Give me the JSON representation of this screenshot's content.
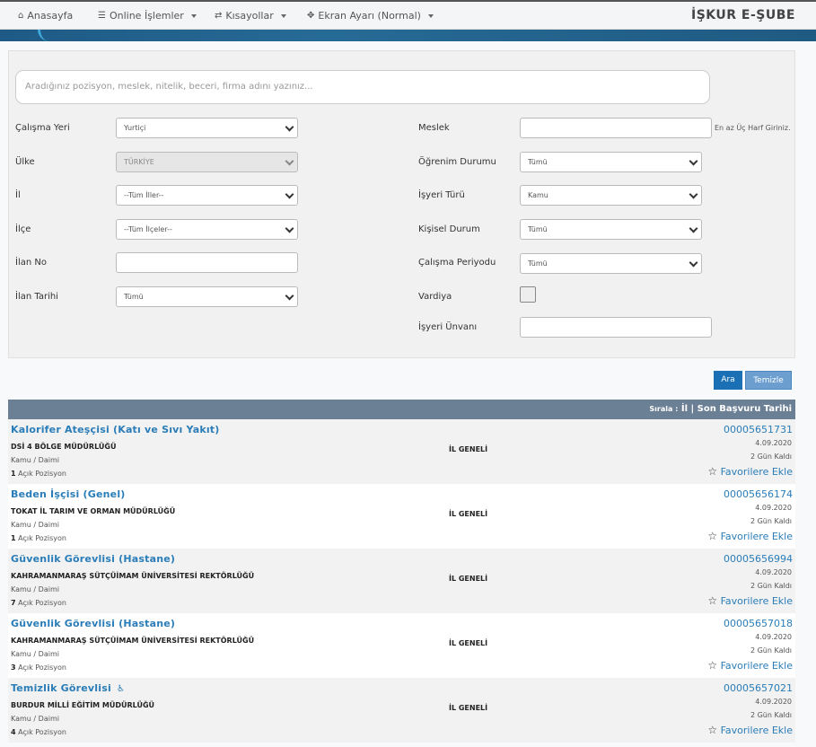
{
  "nav": {
    "home": "Anasayfa",
    "online": "Online İşlemler",
    "shortcuts": "Kısayollar",
    "screen": "Ekran Ayarı (Normal)",
    "brand": "İŞKUR E-ŞUBE"
  },
  "search": {
    "placeholder": "Aradığınız pozisyon, meslek, nitelik, beceri, firma adını yazınız..."
  },
  "filters": {
    "calisma_yeri": {
      "label": "Çalışma Yeri",
      "value": "Yurtiçi"
    },
    "ulke": {
      "label": "Ülke",
      "value": "TÜRKİYE"
    },
    "il": {
      "label": "İl",
      "value": "--Tüm İller--"
    },
    "ilce": {
      "label": "İlçe",
      "value": "--Tüm İlçeler--"
    },
    "ilan_no": {
      "label": "İlan No",
      "value": ""
    },
    "ilan_tarihi": {
      "label": "İlan Tarihi",
      "value": "Tümü"
    },
    "meslek": {
      "label": "Meslek",
      "value": "",
      "hint": "En az Üç Harf Giriniz."
    },
    "ogrenim": {
      "label": "Öğrenim Durumu",
      "value": "Tümü"
    },
    "isyeri_turu": {
      "label": "İşyeri Türü",
      "value": "Kamu"
    },
    "kisisel": {
      "label": "Kişisel Durum",
      "value": "Tümü"
    },
    "periyot": {
      "label": "Çalışma Periyodu",
      "value": "Tümü"
    },
    "vardiya": {
      "label": "Vardiya"
    },
    "unvan": {
      "label": "İşyeri Ünvanı",
      "value": ""
    }
  },
  "buttons": {
    "search": "Ara",
    "clear": "Temizle"
  },
  "results": {
    "sort_prefix": "Sırala :",
    "sort_options": "İl | Son Başvuru Tarihi",
    "position_suffix": "Açık Pozisyon",
    "favorite": "Favorilere Ekle",
    "items": [
      {
        "title": "Kalorifer Ateşçisi (Katı ve Sıvı Yakıt)",
        "employer": "DSİ 4 BÖLGE MÜDÜRLÜĞÜ",
        "type": "Kamu / Daimi",
        "positions": "1",
        "region": "İL GENELİ",
        "no": "00005651731",
        "date": "4.09.2020",
        "left": "2 Gün Kaldı"
      },
      {
        "title": "Beden İşçisi (Genel)",
        "employer": "TOKAT İL TARIM VE ORMAN MÜDÜRLÜĞÜ",
        "type": "Kamu / Daimi",
        "positions": "1",
        "region": "İL GENELİ",
        "no": "00005656174",
        "date": "4.09.2020",
        "left": "2 Gün Kaldı"
      },
      {
        "title": "Güvenlik Görevlisi (Hastane)",
        "employer": "KAHRAMANMARAŞ SÜTÇÜİMAM ÜNİVERSİTESİ REKTÖRLÜĞÜ",
        "type": "Kamu / Daimi",
        "positions": "7",
        "region": "İL GENELİ",
        "no": "00005656994",
        "date": "4.09.2020",
        "left": "2 Gün Kaldı"
      },
      {
        "title": "Güvenlik Görevlisi (Hastane)",
        "employer": "KAHRAMANMARAŞ SÜTÇÜİMAM ÜNİVERSİTESİ REKTÖRLÜĞÜ",
        "type": "Kamu / Daimi",
        "positions": "3",
        "region": "İL GENELİ",
        "no": "00005657018",
        "date": "4.09.2020",
        "left": "2 Gün Kaldı"
      },
      {
        "title": "Temizlik Görevlisi",
        "employer": "BURDUR MİLLİ EĞİTİM MÜDÜRLÜĞÜ",
        "type": "Kamu / Daimi",
        "positions": "4",
        "region": "İL GENELİ",
        "no": "00005657021",
        "date": "4.09.2020",
        "left": "2 Gün Kaldı"
      }
    ]
  },
  "colors": {
    "accent": "#2a7db8",
    "header": "#6b7f95",
    "banner": "#1e5a85"
  }
}
